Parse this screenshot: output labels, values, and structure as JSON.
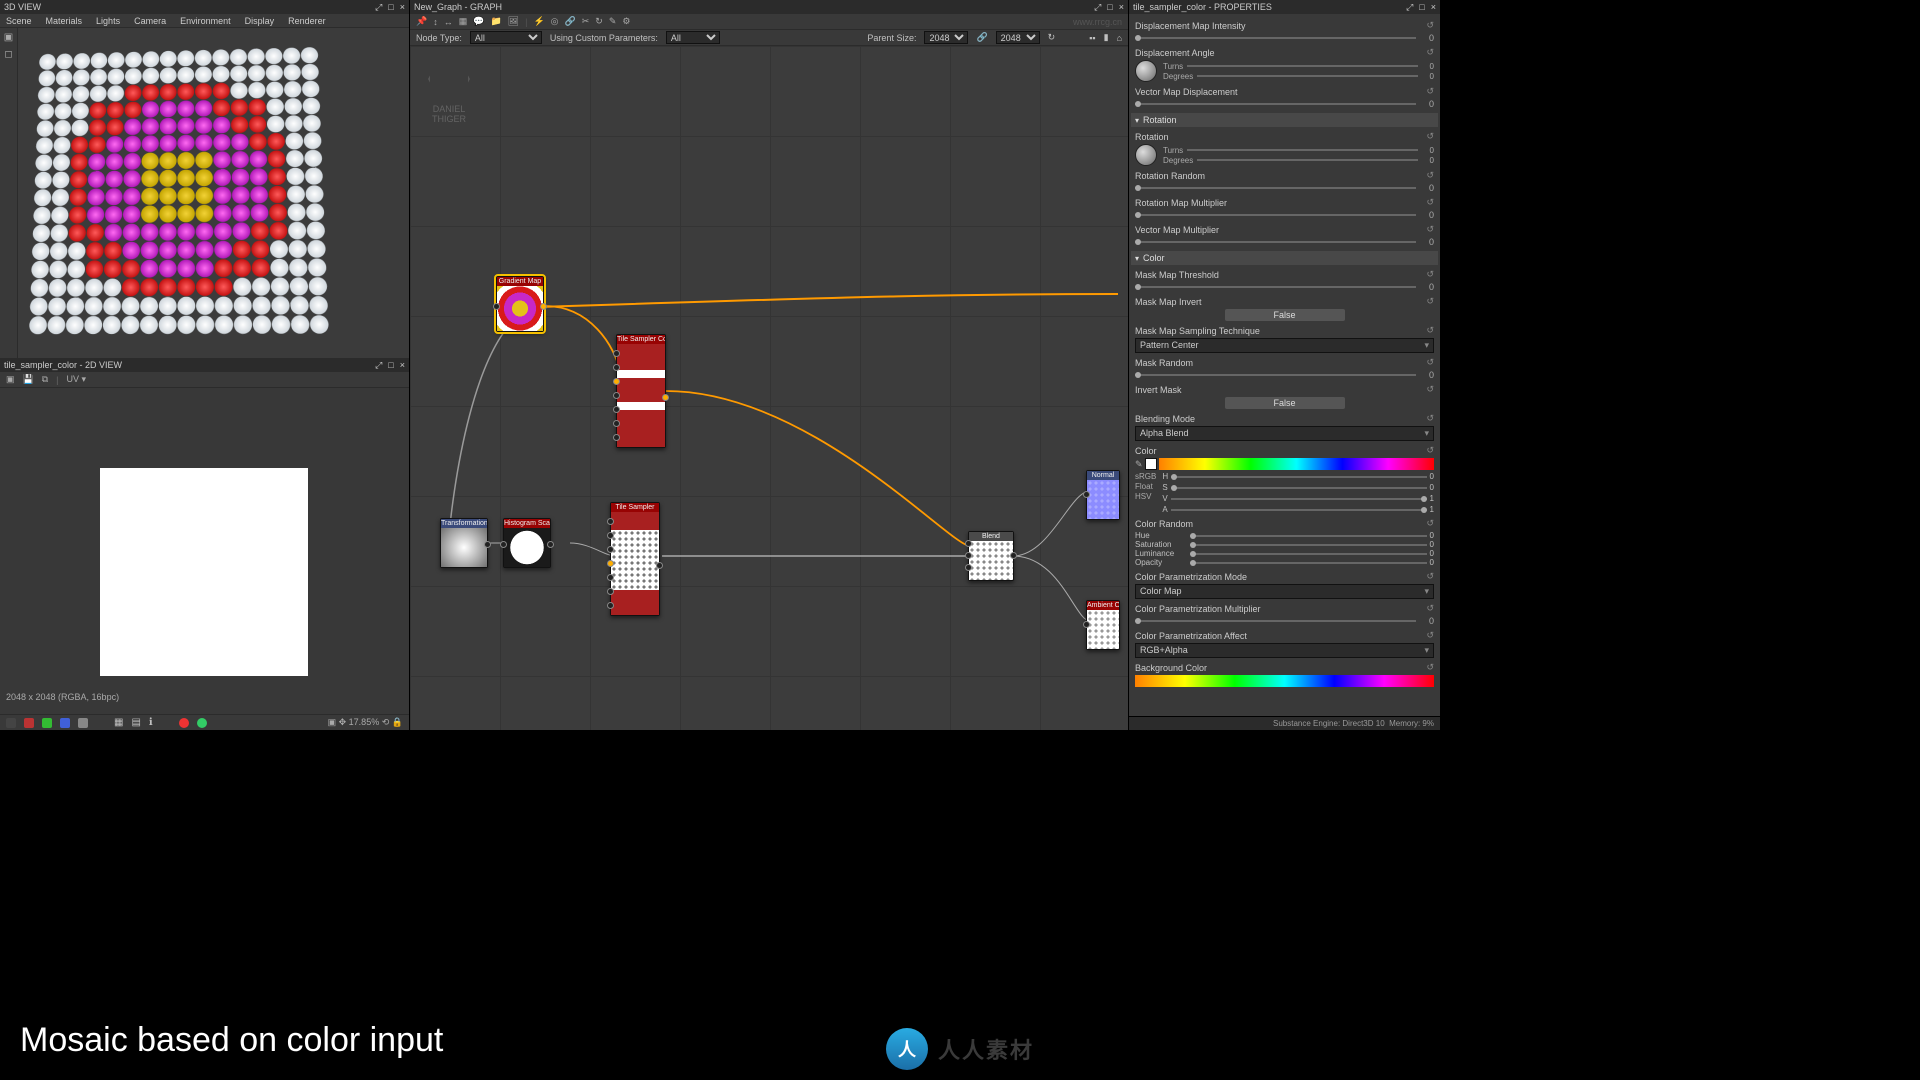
{
  "panels": {
    "view3d_title": "3D VIEW",
    "view3d_menus": [
      "Scene",
      "Materials",
      "Lights",
      "Camera",
      "Environment",
      "Display",
      "Renderer"
    ],
    "view2d_title": "tile_sampler_color - 2D VIEW",
    "view2d_uv_label": "UV ▾",
    "view2d_status": "2048 x 2048 (RGBA, 16bpc)",
    "view2d_zoom": "17.85%",
    "graph_title": "New_Graph - GRAPH",
    "props_title": "tile_sampler_color - PROPERTIES"
  },
  "graph_toolbar": {
    "node_type_label": "Node Type:",
    "node_type_value": "All",
    "using_label": "Using Custom Parameters:",
    "using_value": "All",
    "parent_label": "Parent Size:",
    "parent_w": "2048",
    "parent_h": "2048"
  },
  "branding": {
    "line1": "DANIEL",
    "line2": "THIGER",
    "url_wm": "www.rrcg.cn"
  },
  "nodes": {
    "gradient_map": "Gradient Map",
    "tile_sampler_color": "Tile Sampler Color",
    "transformation": "Transformation…",
    "histogram_scan": "Histogram Scan",
    "tile_sampler": "Tile Sampler",
    "blend": "Blend",
    "normal": "Normal",
    "ambient_occ": "Ambient O…"
  },
  "properties": {
    "displacement_map_intensity": {
      "label": "Displacement Map Intensity",
      "value": 0
    },
    "displacement_angle": {
      "label": "Displacement Angle",
      "turns": "Turns",
      "degrees": "Degrees",
      "t": 0,
      "d": 0
    },
    "vector_map_displacement": {
      "label": "Vector Map Displacement",
      "value": 0
    },
    "section_rotation": "Rotation",
    "rotation": {
      "label": "Rotation",
      "turns": "Turns",
      "degrees": "Degrees",
      "t": 0,
      "d": 0
    },
    "rotation_random": {
      "label": "Rotation Random",
      "value": 0
    },
    "rotation_map_multiplier": {
      "label": "Rotation Map Multiplier",
      "value": 0
    },
    "vector_map_multiplier": {
      "label": "Vector Map Multiplier",
      "value": 0
    },
    "section_color": "Color",
    "mask_map_threshold": {
      "label": "Mask Map Threshold",
      "value": 0
    },
    "mask_map_invert": {
      "label": "Mask Map Invert",
      "value": "False"
    },
    "mask_map_sampling": {
      "label": "Mask Map Sampling Technique",
      "value": "Pattern Center"
    },
    "mask_random": {
      "label": "Mask Random",
      "value": 0
    },
    "invert_mask": {
      "label": "Invert Mask",
      "value": "False"
    },
    "blending_mode": {
      "label": "Blending Mode",
      "value": "Alpha Blend"
    },
    "color": {
      "label": "Color",
      "mode_a": "sRGB",
      "mode_b": "Float",
      "mode_c": "HSV",
      "H": "H",
      "S": "S",
      "V": "V",
      "A": "A",
      "hv": 0,
      "sv": 0,
      "vv": 1,
      "av": 1
    },
    "color_random": {
      "label": "Color Random",
      "hue": "Hue",
      "sat": "Saturation",
      "lum": "Luminance",
      "opa": "Opacity",
      "huev": 0,
      "satv": 0,
      "lumv": 0,
      "opav": 0
    },
    "color_param_mode": {
      "label": "Color Parametrization Mode",
      "value": "Color Map"
    },
    "color_param_mult": {
      "label": "Color Parametrization Multiplier",
      "value": 0
    },
    "color_param_affect": {
      "label": "Color Parametrization Affect",
      "value": "RGB+Alpha"
    },
    "background_color": {
      "label": "Background Color"
    }
  },
  "footer": {
    "engine": "Substance Engine: Direct3D 10",
    "memory": "Memory: 9%"
  },
  "caption": "Mosaic based on color input",
  "rrcg": "人人素材"
}
